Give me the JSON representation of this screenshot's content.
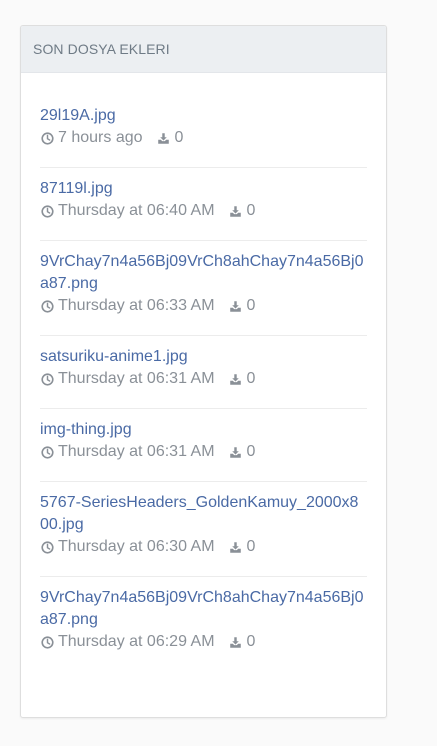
{
  "panel": {
    "title": "SON DOSYA EKLERI"
  },
  "files": [
    {
      "name": "29l19A.jpg",
      "time": "7 hours ago",
      "downloads": "0"
    },
    {
      "name": "87119l.jpg",
      "time": "Thursday at 06:40 AM",
      "downloads": "0"
    },
    {
      "name": "9VrChay7n4a56Bj09VrCh8ahChay7n4a56Bj0a87.png",
      "time": "Thursday at 06:33 AM",
      "downloads": "0"
    },
    {
      "name": "satsuriku-anime1.jpg",
      "time": "Thursday at 06:31 AM",
      "downloads": "0"
    },
    {
      "name": "img-thing.jpg",
      "time": "Thursday at 06:31 AM",
      "downloads": "0"
    },
    {
      "name": "5767-SeriesHeaders_GoldenKamuy_2000x800.jpg",
      "time": "Thursday at 06:30 AM",
      "downloads": "0"
    },
    {
      "name": "9VrChay7n4a56Bj09VrCh8ahChay7n4a56Bj0a87.png",
      "time": "Thursday at 06:29 AM",
      "downloads": "0"
    }
  ],
  "icons": {
    "time": "clock-icon",
    "downloads": "download-icon"
  },
  "colors": {
    "link": "#4a6aa5",
    "meta": "#8a9097",
    "header_bg": "#eceff2"
  }
}
